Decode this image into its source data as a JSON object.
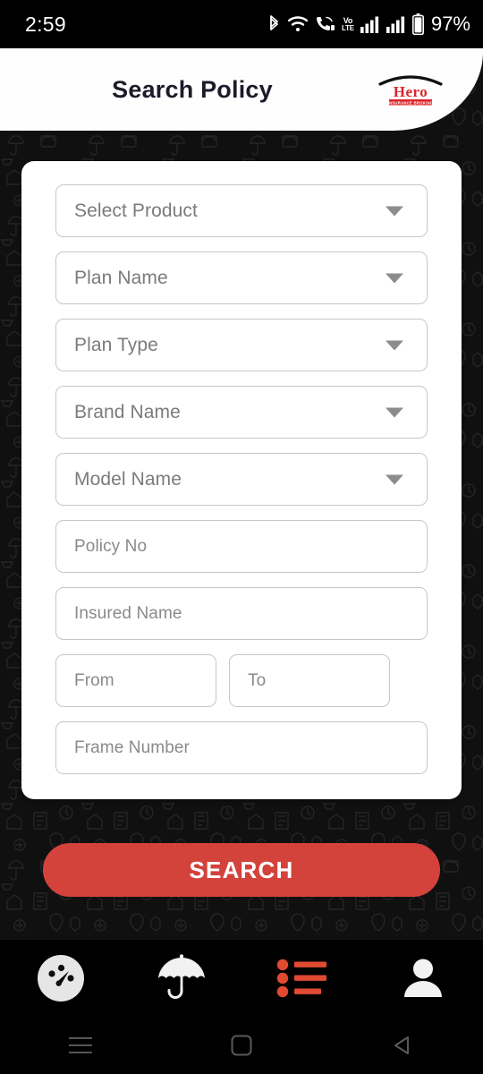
{
  "status_bar": {
    "time": "2:59",
    "battery_percent": "97%",
    "icons": [
      "bluetooth-icon",
      "wifi-icon",
      "call-icon",
      "volte-icon",
      "signal-bars-icon-1",
      "signal-bars-icon-2",
      "battery-icon"
    ],
    "volte_top": "Vo",
    "volte_bottom": "LTE"
  },
  "header": {
    "title": "Search Policy",
    "logo": {
      "name": "Hero",
      "tagline": "INSURANCE BROKING",
      "name_color": "#d9262c",
      "arc_color": "#111111",
      "bar_color": "#d9262c"
    }
  },
  "form": {
    "fields": [
      {
        "name": "select-product",
        "placeholder": "Select Product",
        "type": "dropdown"
      },
      {
        "name": "plan-name",
        "placeholder": "Plan Name",
        "type": "dropdown"
      },
      {
        "name": "plan-type",
        "placeholder": "Plan Type",
        "type": "dropdown"
      },
      {
        "name": "brand-name",
        "placeholder": "Brand Name",
        "type": "dropdown"
      },
      {
        "name": "model-name",
        "placeholder": "Model Name",
        "type": "dropdown"
      },
      {
        "name": "policy-no",
        "placeholder": "Policy No",
        "type": "text"
      },
      {
        "name": "insured-name",
        "placeholder": "Insured Name",
        "type": "text"
      },
      {
        "name": "from-date",
        "placeholder": "From",
        "type": "text"
      },
      {
        "name": "to-date",
        "placeholder": "To",
        "type": "text"
      },
      {
        "name": "frame-number",
        "placeholder": "Frame Number",
        "type": "text"
      }
    ]
  },
  "search_button": {
    "label": "SEARCH",
    "color": "#d4423c",
    "text_color": "#ffffff"
  },
  "bottom_nav": {
    "items": [
      {
        "name": "dashboard",
        "icon": "speedometer-icon",
        "active": false,
        "color": "#e6e6e6"
      },
      {
        "name": "policies",
        "icon": "umbrella-icon",
        "active": false,
        "color": "#f2f2f2"
      },
      {
        "name": "list",
        "icon": "list-icon",
        "active": true,
        "color": "#e14a32"
      },
      {
        "name": "profile",
        "icon": "person-icon",
        "active": false,
        "color": "#f2f2f2"
      }
    ],
    "active_color": "#e14a32"
  },
  "android_nav": {
    "buttons": [
      {
        "name": "recents",
        "icon": "hamburger-icon"
      },
      {
        "name": "home",
        "icon": "square-icon"
      },
      {
        "name": "back",
        "icon": "triangle-left-icon"
      }
    ]
  }
}
